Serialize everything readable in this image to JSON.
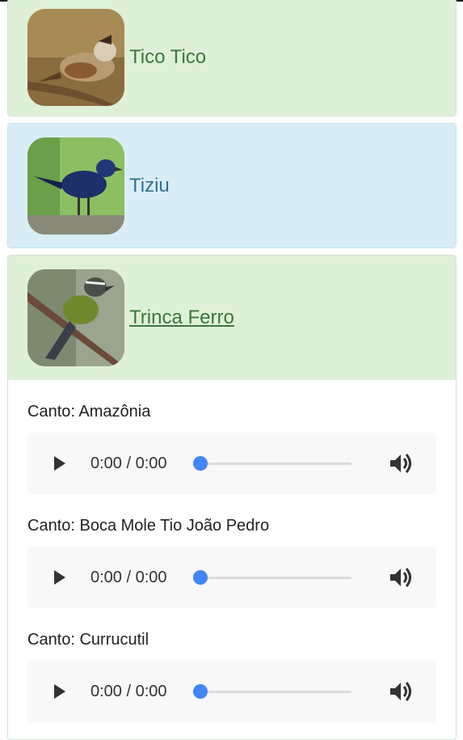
{
  "birds": [
    {
      "name": "Tico Tico",
      "image": "rufous-collared-sparrow-photo"
    },
    {
      "name": "Tiziu",
      "image": "blue-black-grassquit-photo"
    },
    {
      "name": "Trinca Ferro",
      "image": "green-winged-saltator-photo"
    }
  ],
  "tracks": [
    {
      "label": "Canto: Amazônia",
      "time": "0:00 / 0:00"
    },
    {
      "label": "Canto: Boca Mole Tio João Pedro",
      "time": "0:00 / 0:00"
    },
    {
      "label": "Canto: Currucutil",
      "time": "0:00 / 0:00"
    }
  ],
  "player": {
    "progress": 0,
    "icons": {
      "play": "play-icon",
      "volume": "volume-icon"
    },
    "accent": "#4285f4"
  },
  "colors": {
    "success_bg": "#dff0d8",
    "success_text": "#3c763d",
    "info_bg": "#d9edf7",
    "info_text": "#31708f"
  }
}
